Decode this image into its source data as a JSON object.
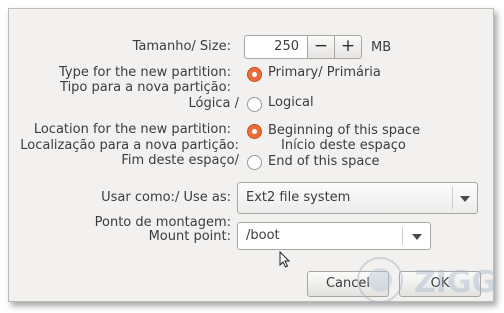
{
  "size": {
    "label": "Tamanho/ Size:",
    "value": "250",
    "minus": "−",
    "plus": "+",
    "unit": "MB"
  },
  "type": {
    "label_en": "Type for the new partition:",
    "label_pt": "Tipo para a nova partição:",
    "primary_label": "Primary/ Primária",
    "logical_prefix": "Lógica /",
    "logical_label": "Logical",
    "selected": "primary"
  },
  "location": {
    "label_en": "Location for the new partition:",
    "label_pt": "Localização para a nova partição:",
    "beginning_label": "Beginning of this space",
    "beginning_pt": "Início deste espaço",
    "end_prefix": "Fim deste espaço/",
    "end_label": "End of this space",
    "selected": "beginning"
  },
  "use_as": {
    "label": "Usar como:/ Use as:",
    "value": "Ext2 file system"
  },
  "mount": {
    "label_pt": "Ponto de montagem:",
    "label_en": "Mount point:",
    "value": "/boot"
  },
  "buttons": {
    "cancel": "Cancel",
    "ok": "OK"
  },
  "watermark": {
    "text": "ZIGG"
  },
  "colors": {
    "accent": "#ec6c3c",
    "dialog_bg": "#f2f1f0"
  }
}
